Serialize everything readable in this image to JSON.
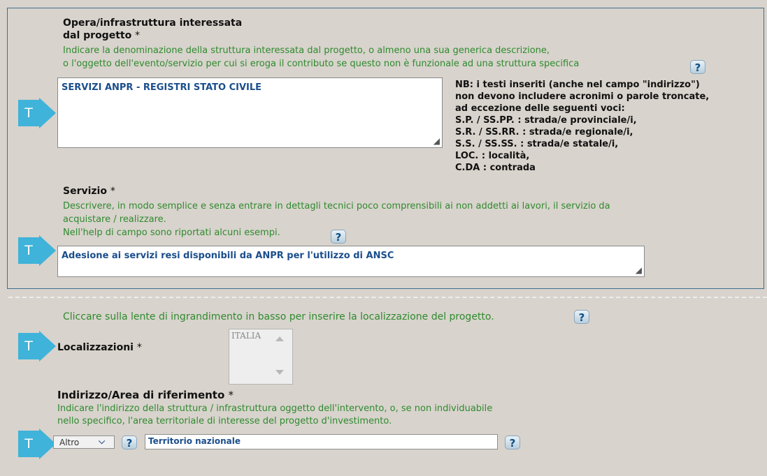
{
  "opera": {
    "label": "Opera/infrastruttura interessata",
    "label_line2": "dal progetto",
    "required": "*",
    "hint_line1": "Indicare la denominazione della struttura interessata dal progetto, o almeno una sua generica descrizione,",
    "hint_line2": "o l'oggetto dell'evento/servizio per cui si eroga il contributo se questo non è funzionale ad una struttura specifica",
    "value": "SERVIZI ANPR - REGISTRI STATO CIVILE",
    "help": "?"
  },
  "nb": {
    "lines": [
      "NB: i testi inseriti (anche nel campo \"indirizzo\")",
      "non devono includere acronimi o parole troncate,",
      "ad eccezione delle seguenti voci:",
      "S.P. / SS.PP. : strada/e provinciale/i,",
      "S.R. / SS.RR. : strada/e regionale/i,",
      "S.S. / SS.SS. : strada/e statale/i,",
      "LOC. : località,",
      "C.DA : contrada"
    ]
  },
  "servizio": {
    "label": "Servizio",
    "required": "*",
    "hint_line1": "Descrivere, in modo semplice e senza entrare in dettagli tecnici poco comprensibili ai non addetti ai lavori, il servizio da",
    "hint_line2": "acquistare / realizzare.",
    "hint_line3": "Nell'help di campo sono riportati alcuni esempi.",
    "value": "Adesione ai servizi resi disponibili da ANPR per l'utilizzo di ANSC",
    "help": "?"
  },
  "localizzazioni": {
    "hint": "Cliccare sulla lente di ingrandimento in basso per inserire la localizzazione del progetto.",
    "label": "Localizzazioni",
    "required": "*",
    "items": [
      "ITALIA"
    ],
    "help": "?"
  },
  "indirizzo": {
    "label": "Indirizzo/Area di riferimento",
    "required": "*",
    "hint_line1": "Indicare l'indirizzo della struttura / infrastruttura oggetto dell'intervento, o, se non individuabile",
    "hint_line2": "nello specifico, l'area territoriale di interesse del progetto d'investimento.",
    "select_value": "Altro",
    "value": "Territorio nazionale",
    "help": "?"
  },
  "badge_letter": "T",
  "colors": {
    "accent": "#3fb3d9",
    "hint": "#2f8a2f",
    "value_text": "#1b4e8c",
    "border": "#3f6f8f"
  },
  "icons": [
    "arrow-t-badge-icon",
    "help-question-icon",
    "resize-grip-icon",
    "chevron-down-icon",
    "scroll-up-icon",
    "scroll-down-icon"
  ]
}
